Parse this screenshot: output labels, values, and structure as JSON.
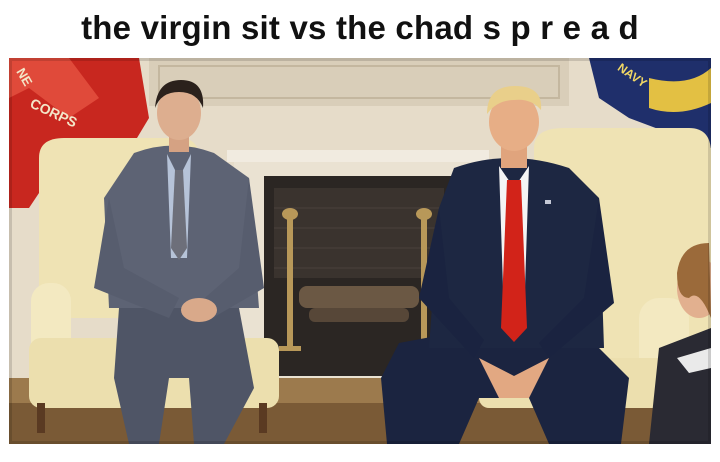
{
  "meme": {
    "caption": "the virgin sit vs the chad s p r e a d"
  },
  "photo": {
    "flag_left_text": "CORPS",
    "flag_left_partial": "NE",
    "flag_right_text": "NAVY"
  },
  "colors": {
    "wall": "#e6dcc9",
    "fireplace": "#2b2623",
    "chair": "#efe3b4",
    "left_flag": "#c8271f",
    "right_flag": "#1f2f6b",
    "suit_left": "#5d6374",
    "suit_right": "#1d2742",
    "tie_right": "#d22319"
  }
}
